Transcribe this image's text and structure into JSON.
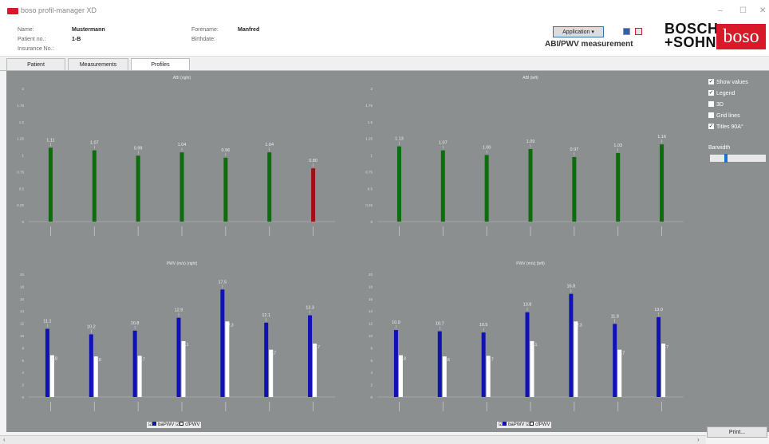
{
  "window": {
    "title": "boso profil-manager XD",
    "controls": [
      "–",
      "☐",
      "✕"
    ]
  },
  "patient": {
    "name_label": "Name:",
    "name_value": "Mustermann",
    "patient_no_label": "Patient no.:",
    "patient_no_value": "1-B",
    "insurance_label": "Insurance No.:",
    "forename_label": "Forename:",
    "forename_value": "Manfred",
    "birthdate_label": "Birthdate:"
  },
  "header": {
    "application_button": "Application ▾",
    "measurement_title": "ABI/PWV measurement",
    "logo_bosch": "BOSCH +SOHN",
    "logo_boso": "boso"
  },
  "tabs": [
    "Patient",
    "Measurements",
    "Profiles"
  ],
  "options": {
    "checkboxes": [
      {
        "label": "Show values",
        "checked": true
      },
      {
        "label": "Legend",
        "checked": true
      },
      {
        "label": "3D",
        "checked": false
      },
      {
        "label": "Grid lines",
        "checked": false
      },
      {
        "label": "Titles 90A°",
        "checked": true
      }
    ],
    "barwidth_label": "Barwidth",
    "barwidth_value": 0.25
  },
  "print_button": "Print...",
  "colors": {
    "green": "#0e6b0e",
    "red": "#9d1313",
    "blue": "#1111b8",
    "white": "#ffffff",
    "plot_bg": "#8b8f8f"
  },
  "chart_data": [
    {
      "type": "bar",
      "title": "ABI (right)",
      "categories": [
        "",
        "",
        "",
        "",
        "",
        "",
        ""
      ],
      "ylim": [
        0,
        2
      ],
      "yticks": [
        "2",
        "1.75",
        "1.5",
        "1.25",
        "1",
        "0.75",
        "0.5",
        "0.25",
        "0"
      ],
      "series": [
        {
          "values": [
            1.11,
            1.07,
            0.99,
            1.04,
            0.96,
            1.04,
            0.8
          ],
          "colors": [
            "#0e6b0e",
            "#0e6b0e",
            "#0e6b0e",
            "#0e6b0e",
            "#0e6b0e",
            "#0e6b0e",
            "#9d1313"
          ]
        }
      ],
      "labels": [
        "1.11",
        "1.07",
        "0.99",
        "1.04",
        "0.96",
        "1.04",
        "0.80"
      ]
    },
    {
      "type": "bar",
      "title": "ABI (left)",
      "categories": [
        "",
        "",
        "",
        "",
        "",
        "",
        ""
      ],
      "ylim": [
        0,
        2
      ],
      "yticks": [
        "2",
        "1.75",
        "1.5",
        "1.25",
        "1",
        "0.75",
        "0.5",
        "0.25",
        "0"
      ],
      "series": [
        {
          "values": [
            1.13,
            1.07,
            1.0,
            1.09,
            0.97,
            1.03,
            1.16
          ],
          "colors": [
            "#0e6b0e",
            "#0e6b0e",
            "#0e6b0e",
            "#0e6b0e",
            "#0e6b0e",
            "#0e6b0e",
            "#0e6b0e"
          ]
        }
      ],
      "labels": [
        "1.13",
        "1.07",
        "1.00",
        "1.09",
        "0.97",
        "1.03",
        "1.16"
      ]
    },
    {
      "type": "bar",
      "title": "PWV (m/s) (right)",
      "categories": [
        "",
        "",
        "",
        "",
        "",
        "",
        ""
      ],
      "ylim": [
        0,
        20
      ],
      "yticks": [
        "20",
        "18",
        "16",
        "14",
        "12",
        "10",
        "8",
        "6",
        "4",
        "2",
        "0"
      ],
      "series": [
        {
          "name": "baPWV",
          "values": [
            11.1,
            10.2,
            10.8,
            12.9,
            17.5,
            12.1,
            13.3
          ],
          "labels": [
            "11.1",
            "10.2",
            "10.8",
            "12.9",
            "17.5",
            "12.1",
            "13.3"
          ]
        },
        {
          "name": "cfPWV",
          "values": [
            6.8,
            6.6,
            6.7,
            9.1,
            12.3,
            7.7,
            8.7
          ],
          "labels": [
            "6.8",
            "6.6",
            "6.7",
            "9.1",
            "12.3",
            "7.7",
            "8.7"
          ]
        }
      ],
      "legend": [
        "baPWV",
        "cfPWV"
      ]
    },
    {
      "type": "bar",
      "title": "PWV (m/s) (left)",
      "categories": [
        "",
        "",
        "",
        "",
        "",
        "",
        ""
      ],
      "ylim": [
        0,
        20
      ],
      "yticks": [
        "20",
        "18",
        "16",
        "14",
        "12",
        "10",
        "8",
        "6",
        "4",
        "2",
        "0"
      ],
      "series": [
        {
          "name": "baPWV",
          "values": [
            10.9,
            10.7,
            10.5,
            13.8,
            16.8,
            11.9,
            13.0
          ],
          "labels": [
            "10.9",
            "10.7",
            "10.5",
            "13.8",
            "16.8",
            "11.9",
            "13.0"
          ]
        },
        {
          "name": "cfPWV",
          "values": [
            6.8,
            6.6,
            6.7,
            9.1,
            12.3,
            7.7,
            8.7
          ],
          "labels": [
            "6.8",
            "6.6",
            "6.7",
            "9.1",
            "12.3",
            "7.7",
            "8.7"
          ]
        }
      ],
      "legend": [
        "baPWV",
        "cfPWV"
      ]
    }
  ]
}
